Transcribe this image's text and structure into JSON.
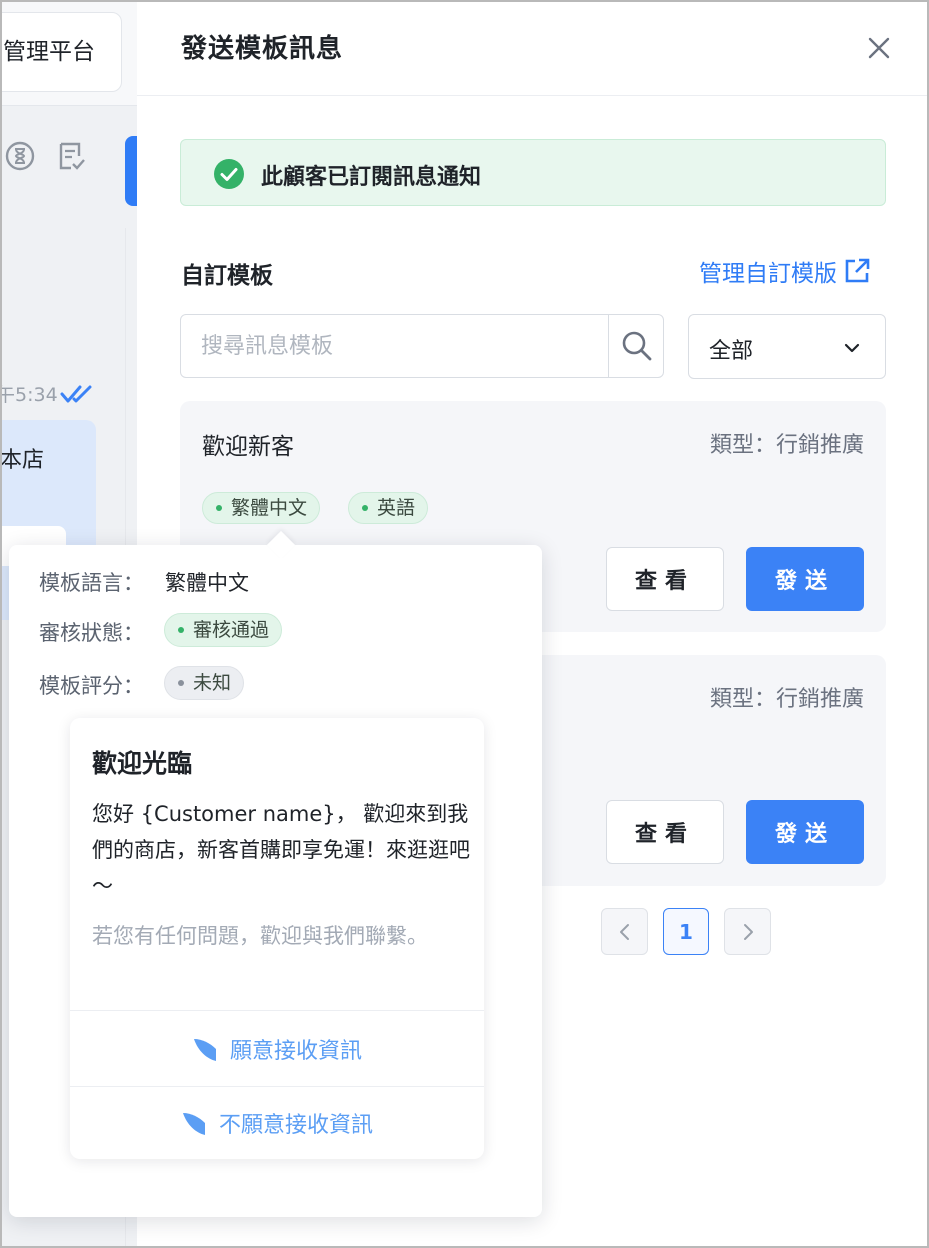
{
  "background_app": {
    "title": "管理平台",
    "message_time": "午5:34",
    "message_text": "本店"
  },
  "drawer": {
    "title": "發送模板訊息",
    "alert_text": "此顧客已訂閱訊息通知",
    "section_title": "自訂模板",
    "manage_link": "管理自訂模版",
    "search": {
      "placeholder": "搜尋訊息模板",
      "value": ""
    },
    "filter": {
      "selected": "全部"
    },
    "templates": [
      {
        "name": "歡迎新客",
        "type": "類型：行銷推廣",
        "languages": [
          "繁體中文",
          "英語"
        ],
        "view_label": "查看",
        "send_label": "發送"
      },
      {
        "name": "",
        "type": "類型：行銷推廣",
        "view_label": "查看",
        "send_label": "發送"
      }
    ],
    "pagination": {
      "current_page": "1"
    }
  },
  "popover": {
    "language_label": "模板語言：",
    "language_value": "繁體中文",
    "status_label": "審核狀態：",
    "status_value": "審核通過",
    "rating_label": "模板評分：",
    "rating_value": "未知",
    "preview": {
      "title": "歡迎光臨",
      "body": "您好 {Customer name}， 歡迎來到我們的商店，新客首購即享免運！來逛逛吧～",
      "footer": "若您有任何問題，歡迎與我們聯繫。",
      "buttons": [
        "願意接收資訊",
        "不願意接收資訊"
      ]
    }
  },
  "colors": {
    "primary": "#3b82f6",
    "success": "#34b268",
    "alert_bg": "#e8f7ee",
    "card_bg": "#f5f6f9"
  }
}
